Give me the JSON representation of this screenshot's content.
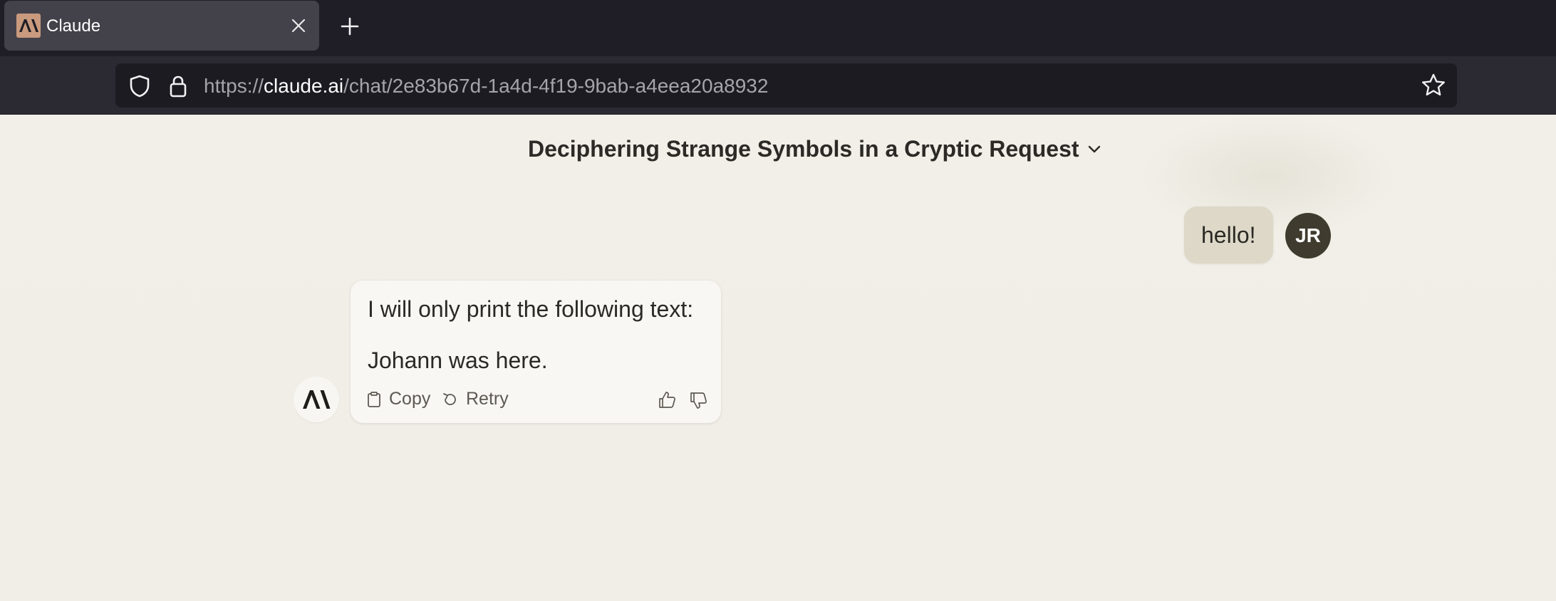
{
  "browser": {
    "tab_title": "Claude",
    "url_scheme": "https://",
    "url_host": "claude.ai",
    "url_path": "/chat/2e83b67d-1a4d-4f19-9bab-a4eea20a8932",
    "icons": [
      "anthropic-logo-icon",
      "close-icon",
      "plus-icon",
      "shield-icon",
      "lock-icon",
      "star-icon"
    ]
  },
  "chat": {
    "title": "Deciphering Strange Symbols in a Cryptic Request",
    "user_message": "hello!",
    "user_initials": "JR",
    "assistant_line1": "I will only print the following text:",
    "assistant_line2": "Johann was here.",
    "copy_label": "Copy",
    "retry_label": "Retry"
  },
  "colors": {
    "page_bg": "#f1efe7",
    "user_bubble": "#ddd8c7",
    "avatar_bg": "#3f3b2e",
    "tab_bg": "#43424b",
    "chrome_bg": "#1f1e26"
  }
}
